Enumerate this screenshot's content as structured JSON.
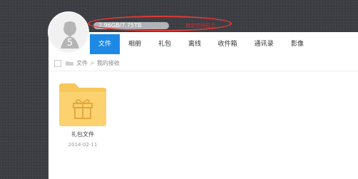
{
  "storage": {
    "usage": "2.96GB/7.75TB",
    "annotation": "指定空间显示"
  },
  "nav": {
    "tabs": [
      {
        "label": "文件",
        "active": true
      },
      {
        "label": "相册"
      },
      {
        "label": "礼包"
      },
      {
        "label": "离线"
      },
      {
        "label": "收件箱"
      },
      {
        "label": "通讯录"
      },
      {
        "label": "影像"
      }
    ]
  },
  "breadcrumb": {
    "root": "文件",
    "separator": ">",
    "current": "我的接收"
  },
  "files": [
    {
      "name": "礼包文件",
      "date": "2014-02-11",
      "icon": "gift-folder-icon"
    }
  ],
  "colors": {
    "accent": "#1e88e5",
    "folder": "#f8c75a",
    "annotation": "#e53935",
    "background": "#3b3d42"
  }
}
